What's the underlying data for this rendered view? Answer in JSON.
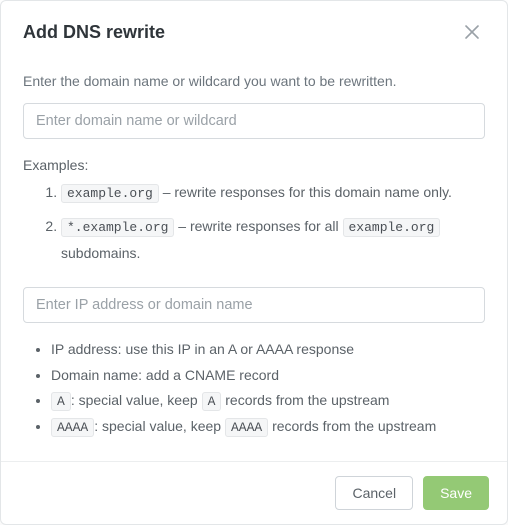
{
  "dialog": {
    "title": "Add DNS rewrite",
    "close_aria": "Close"
  },
  "body": {
    "instruction": "Enter the domain name or wildcard you want to be rewritten.",
    "domain_input": {
      "value": "",
      "placeholder": "Enter domain name or wildcard"
    },
    "examples_label": "Examples:",
    "examples": [
      {
        "code": "example.org",
        "text_before": "",
        "text_after": " – rewrite responses for this domain name only."
      },
      {
        "code": "*.example.org",
        "text_before": "",
        "text_mid": " – rewrite responses for all ",
        "code2": "example.org",
        "text_after": " subdomains."
      }
    ],
    "target_input": {
      "value": "",
      "placeholder": "Enter IP address or domain name"
    },
    "notes": [
      {
        "parts": [
          {
            "t": "text",
            "v": "IP address: use this IP in an A or AAAA response"
          }
        ]
      },
      {
        "parts": [
          {
            "t": "text",
            "v": "Domain name: add a CNAME record"
          }
        ]
      },
      {
        "parts": [
          {
            "t": "code",
            "v": "A"
          },
          {
            "t": "text",
            "v": ": special value, keep "
          },
          {
            "t": "code",
            "v": "A"
          },
          {
            "t": "text",
            "v": " records from the upstream"
          }
        ]
      },
      {
        "parts": [
          {
            "t": "code",
            "v": "AAAA"
          },
          {
            "t": "text",
            "v": ": special value, keep "
          },
          {
            "t": "code",
            "v": "AAAA"
          },
          {
            "t": "text",
            "v": " records from the upstream"
          }
        ]
      }
    ]
  },
  "footer": {
    "cancel_label": "Cancel",
    "save_label": "Save"
  }
}
